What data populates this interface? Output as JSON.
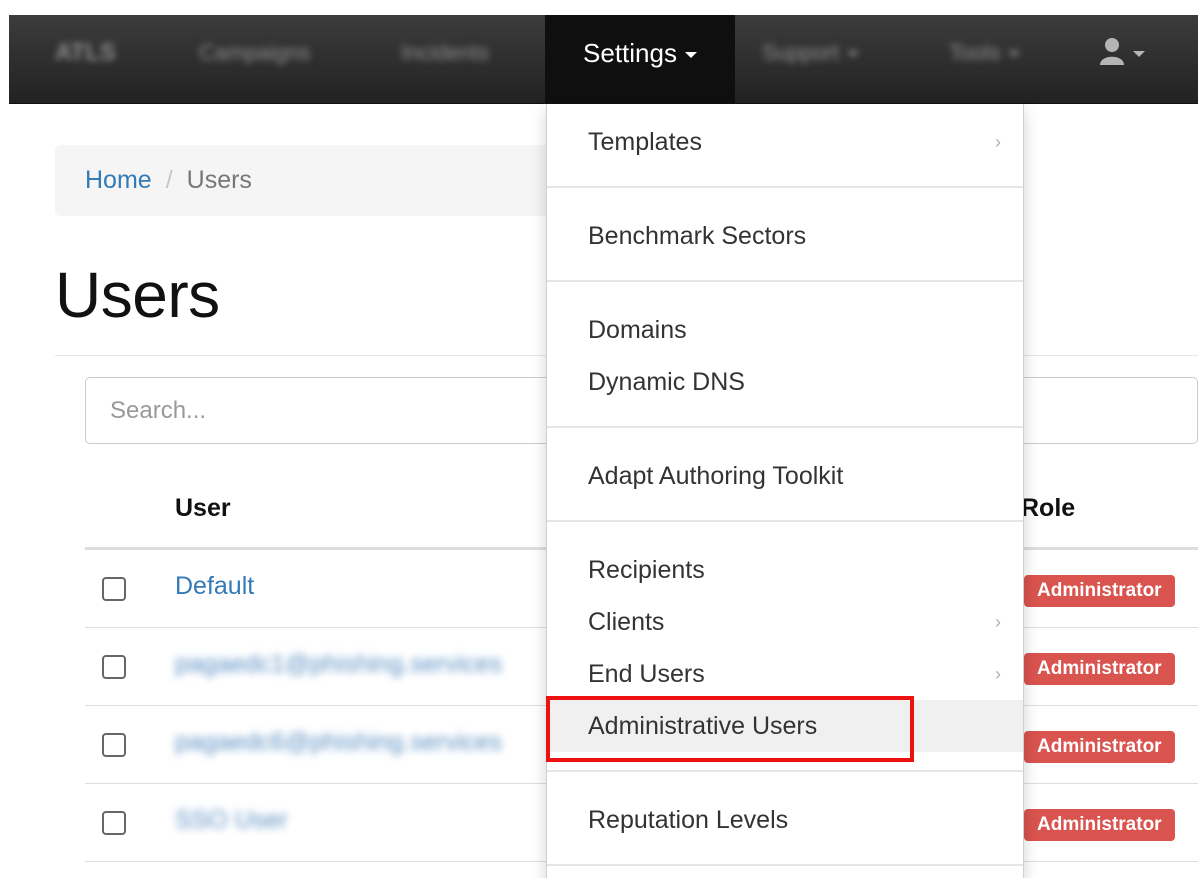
{
  "navbar": {
    "brand": "ATLS",
    "items": [
      "Campaigns",
      "Incidents",
      "Settings",
      "Support",
      "Tools"
    ],
    "user_icon": "user-icon"
  },
  "breadcrumb": {
    "home": "Home",
    "separator": "/",
    "current": "Users"
  },
  "page": {
    "title": "Users"
  },
  "search": {
    "placeholder": "Search..."
  },
  "table": {
    "columns": {
      "user": "User",
      "role": "Role"
    },
    "rows": [
      {
        "user": "Default",
        "role": "Administrator"
      },
      {
        "user": "pagaedc1@phishing.services",
        "role": "Administrator"
      },
      {
        "user": "pagaedc6@phishing.services",
        "role": "Administrator"
      },
      {
        "user": "SSO User",
        "role": "Administrator"
      }
    ]
  },
  "settings_menu": {
    "items": [
      {
        "label": "Templates",
        "has_submenu": true
      },
      {
        "label": "Benchmark Sectors",
        "has_submenu": false
      },
      {
        "label": "Domains",
        "has_submenu": false
      },
      {
        "label": "Dynamic DNS",
        "has_submenu": false
      },
      {
        "label": "Adapt Authoring Toolkit",
        "has_submenu": false
      },
      {
        "label": "Recipients",
        "has_submenu": false
      },
      {
        "label": "Clients",
        "has_submenu": true
      },
      {
        "label": "End Users",
        "has_submenu": true
      },
      {
        "label": "Administrative Users",
        "has_submenu": false,
        "highlighted": true
      },
      {
        "label": "Reputation Levels",
        "has_submenu": false
      }
    ],
    "submenu_arrow": "›"
  },
  "colors": {
    "link": "#337ab7",
    "badge": "#d9534f",
    "highlight": "#ee1111",
    "navbar": "#222222"
  }
}
